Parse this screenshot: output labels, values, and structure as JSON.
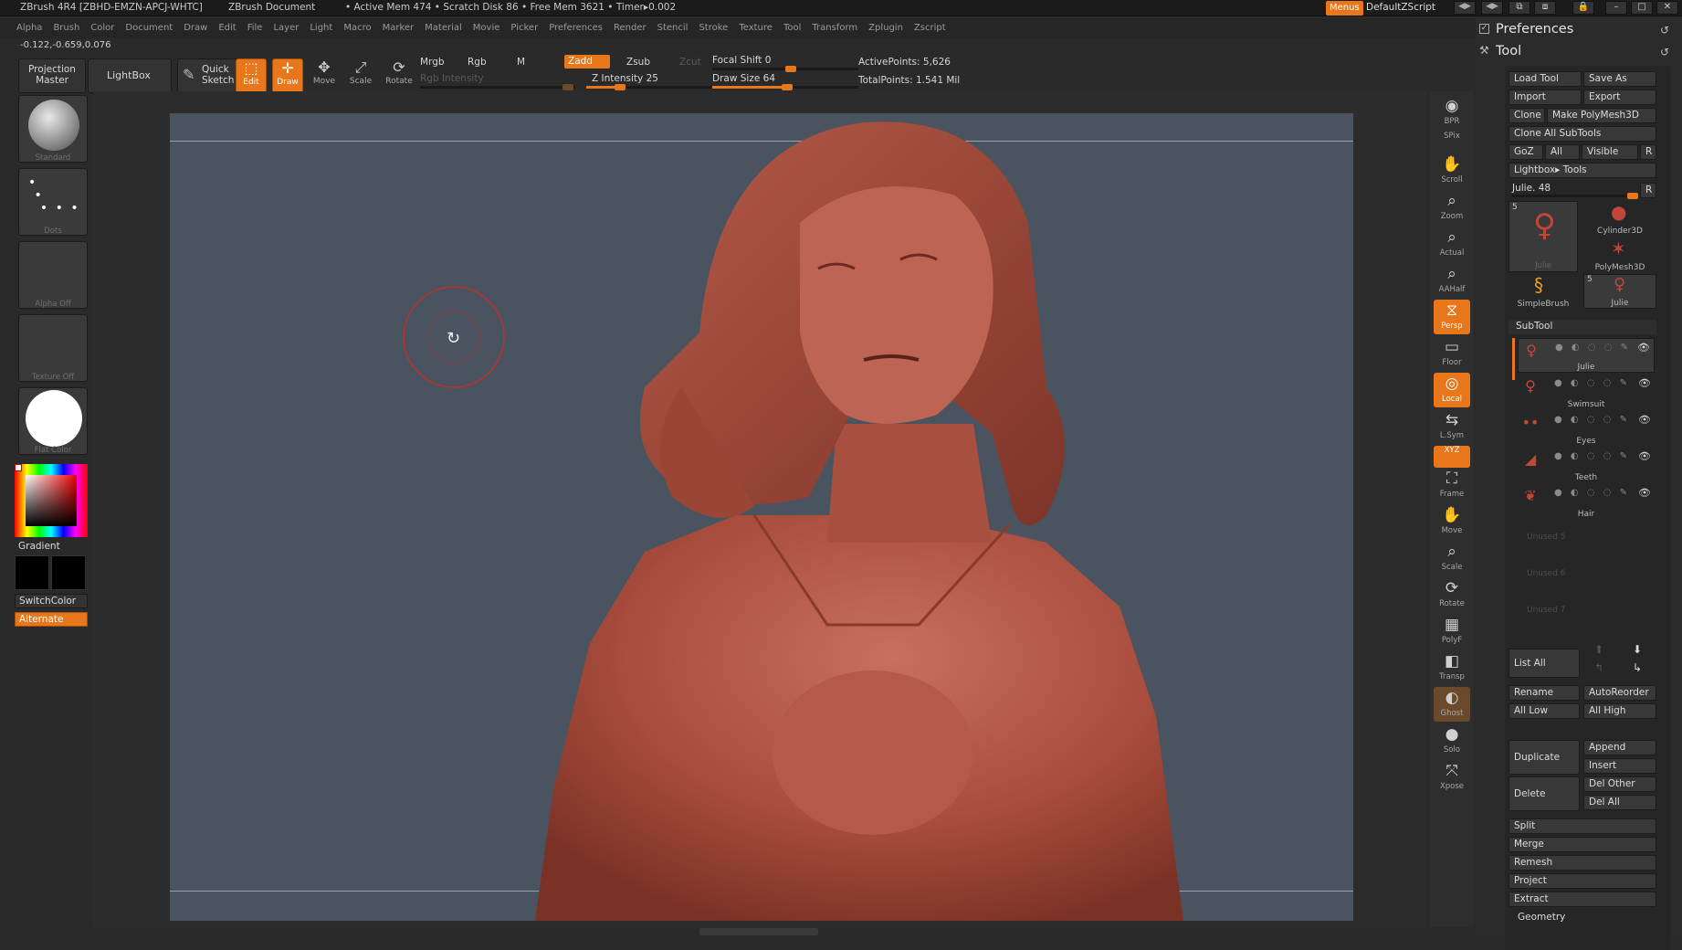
{
  "titlebar": {
    "app": "ZBrush 4R4 [ZBHD-EMZN-APCJ-WHTC]",
    "doc": "ZBrush Document",
    "mem": "• Active Mem 474 • Scratch Disk 86 • Free Mem 3621 • Timer▸0.002",
    "menus_btn": "Menus",
    "script": "DefaultZScript"
  },
  "menubar": [
    "Alpha",
    "Brush",
    "Color",
    "Document",
    "Draw",
    "Edit",
    "File",
    "Layer",
    "Light",
    "Macro",
    "Marker",
    "Material",
    "Movie",
    "Picker",
    "Preferences",
    "Render",
    "Stencil",
    "Stroke",
    "Texture",
    "Tool",
    "Transform",
    "Zplugin",
    "Zscript"
  ],
  "coords": "-0.122,-0.659,0.076",
  "toolbar": {
    "projection_master": "Projection Master",
    "lightbox": "LightBox",
    "quick_sketch": "Quick Sketch",
    "edit": "Edit",
    "draw": "Draw",
    "move": "Move",
    "scale": "Scale",
    "rotate": "Rotate",
    "mrgb": "Mrgb",
    "rgb": "Rgb",
    "m": "M",
    "rgb_intensity": "Rgb Intensity",
    "zadd": "Zadd",
    "zsub": "Zsub",
    "zcut": "Zcut",
    "z_intensity": "Z Intensity 25",
    "focal_shift": "Focal Shift 0",
    "draw_size": "Draw Size 64",
    "active_points": "ActivePoints: 5,626",
    "total_points": "TotalPoints: 1.541 Mil",
    "z_intensity_value": 25,
    "focal_shift_value": 0,
    "draw_size_value": 64
  },
  "leftbar": {
    "standard": "Standard",
    "dots": "Dots",
    "alpha_off": "Alpha Off",
    "texture_off": "Texture Off",
    "flat_color": "Flat Color",
    "gradient": "Gradient",
    "switchcolor": "SwitchColor",
    "alternate": "Alternate"
  },
  "shelf": [
    "BPR",
    "SPix",
    "Scroll",
    "Zoom",
    "Actual",
    "AAHalf",
    "Persp",
    "Floor",
    "Local",
    "L.Sym",
    "XYZ",
    "Frame",
    "Move",
    "Scale",
    "Rotate",
    "PolyF",
    "Transp",
    "Ghost",
    "Solo",
    "Xpose"
  ],
  "tray": {
    "preferences": "Preferences",
    "tool": "Tool",
    "load_tool": "Load Tool",
    "save_as": "Save As",
    "import": "Import",
    "export": "Export",
    "clone": "Clone",
    "make_polymesh": "Make PolyMesh3D",
    "clone_all": "Clone All SubTools",
    "goz": "GoZ",
    "all": "All",
    "visible": "Visible",
    "r": "R",
    "lightbox_tools": "Lightbox▸ Tools",
    "current_tool": "Julie. 48",
    "tool_thumbs": [
      {
        "name": "Julie",
        "count": "5"
      },
      {
        "name": "Cylinder3D"
      },
      {
        "name": "PolyMesh3D"
      },
      {
        "name": "SimpleBrush"
      },
      {
        "name": "Julie",
        "count": "5"
      }
    ],
    "subtool": "SubTool",
    "subtools": [
      "Julie",
      "Swimsuit",
      "Eyes",
      "Teeth",
      "Hair"
    ],
    "unused": [
      "Unused 5",
      "Unused 6",
      "Unused 7"
    ],
    "list_all": "List All",
    "rename": "Rename",
    "autoreorder": "AutoReorder",
    "all_low": "All Low",
    "all_high": "All High",
    "duplicate": "Duplicate",
    "append": "Append",
    "insert": "Insert",
    "delete": "Delete",
    "del_other": "Del Other",
    "del_all": "Del All",
    "split": "Split",
    "merge": "Merge",
    "remesh": "Remesh",
    "project": "Project",
    "extract": "Extract",
    "geometry": "Geometry"
  },
  "colors": {
    "accent": "#e8761a",
    "clay": "#b65544",
    "canvas": "#4a5360"
  }
}
